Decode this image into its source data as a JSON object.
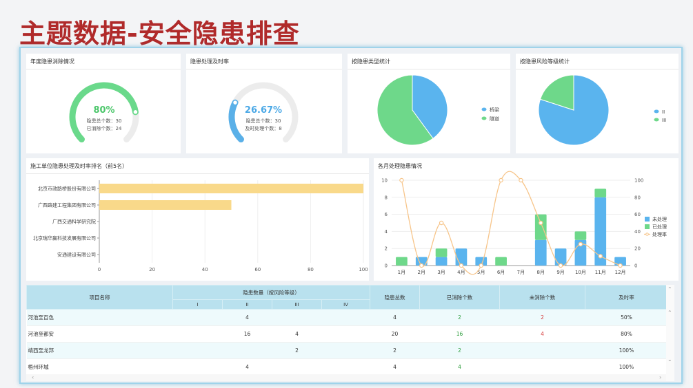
{
  "title": "主题数据-安全隐患排查",
  "panels": {
    "annual": {
      "title": "年度隐患消除情况",
      "percent": "80%",
      "total_line": "隐患总个数：30",
      "done_line": "已消除个数：24",
      "value": 0.8,
      "color": "#6ad98b"
    },
    "timely": {
      "title": "隐患处理及时率",
      "percent": "26.67%",
      "total_line": "隐患总个数：30",
      "done_line": "及时处理个数：8",
      "value": 0.2667,
      "color": "#5ab0e8"
    },
    "type_stats": {
      "title": "按隐患类型统计",
      "legend": [
        "桥梁",
        "隧道"
      ]
    },
    "risk_stats": {
      "title": "按隐患风险等级统计",
      "legend": [
        "II",
        "III"
      ]
    },
    "ranking": {
      "title": "施工单位隐患处理及时率排名（前5名）"
    },
    "monthly": {
      "title": "各月处理隐患情况"
    }
  },
  "chart_data": [
    {
      "type": "pie",
      "labels": [
        "桥梁",
        "隧道"
      ],
      "values": [
        40,
        60
      ],
      "colors": [
        "#5ab4ee",
        "#6ed88a"
      ]
    },
    {
      "type": "pie",
      "labels": [
        "II",
        "III"
      ],
      "values": [
        80,
        20
      ],
      "colors": [
        "#5ab4ee",
        "#6ed88a"
      ]
    },
    {
      "type": "bar",
      "orientation": "horizontal",
      "categories": [
        "北京市政路桥股份有限公司",
        "广西路建工程集团有限公司",
        "广西交通科学研究院",
        "北京瑞华赢科技发展有限公司",
        "安通建设有限公司"
      ],
      "values": [
        100,
        50,
        0,
        0,
        0
      ],
      "xlim": [
        0,
        100
      ],
      "xticks": [
        0,
        20,
        40,
        60,
        80,
        100
      ],
      "color": "#f9d98a"
    },
    {
      "type": "bar",
      "stacked": true,
      "categories": [
        "1月",
        "2月",
        "3月",
        "4月",
        "5月",
        "6月",
        "7月",
        "8月",
        "9月",
        "10月",
        "11月",
        "12月"
      ],
      "series": [
        {
          "name": "未处理",
          "values": [
            0,
            1,
            1,
            2,
            1,
            0,
            0,
            3,
            2,
            3,
            8,
            1
          ],
          "color": "#5ab4ee"
        },
        {
          "name": "已处理",
          "values": [
            1,
            0,
            1,
            0,
            0,
            1,
            0,
            3,
            0,
            1,
            1,
            0
          ],
          "color": "#6ed88a"
        },
        {
          "name": "处理率",
          "type": "line",
          "axis": "right",
          "values": [
            100,
            0,
            50,
            0,
            0,
            100,
            100,
            50,
            0,
            25,
            11,
            0
          ],
          "color": "#f7c58a"
        }
      ],
      "ylim": [
        0,
        10
      ],
      "yticks": [
        0,
        2,
        4,
        6,
        8,
        10
      ],
      "y2lim": [
        0,
        100
      ],
      "y2ticks": [
        0,
        20,
        40,
        60,
        80,
        100
      ]
    }
  ],
  "table": {
    "headers": {
      "name": "项目名称",
      "count_group": "隐患数量（按风险等级）",
      "levels": [
        "I",
        "II",
        "III",
        "IV"
      ],
      "total": "隐患总数",
      "eliminated": "已消除个数",
      "pending": "未消除个数",
      "rate": "及时率"
    },
    "rows": [
      {
        "name": "河池至百色",
        "I": "",
        "II": "4",
        "III": "",
        "IV": "",
        "total": "4",
        "eliminated": "2",
        "pending": "2",
        "rate": "50%"
      },
      {
        "name": "河池至都安",
        "I": "",
        "II": "16",
        "III": "4",
        "IV": "",
        "total": "20",
        "eliminated": "16",
        "pending": "4",
        "rate": "80%"
      },
      {
        "name": "靖西至龙邦",
        "I": "",
        "II": "",
        "III": "2",
        "IV": "",
        "total": "2",
        "eliminated": "2",
        "pending": "",
        "rate": "100%"
      },
      {
        "name": "梧州环城",
        "I": "",
        "II": "4",
        "III": "",
        "IV": "",
        "total": "4",
        "eliminated": "4",
        "pending": "",
        "rate": "100%"
      }
    ]
  }
}
